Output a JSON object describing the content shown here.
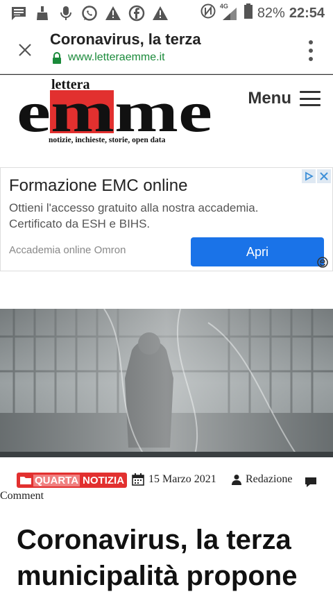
{
  "status_bar": {
    "battery": "82%",
    "time": "22:54",
    "network": "4G",
    "icons": [
      "message-icon",
      "broom-icon",
      "mic-icon",
      "whatsapp-icon",
      "warning-icon",
      "facebook-icon",
      "warning-icon",
      "nfc-icon",
      "signal-icon",
      "battery-icon"
    ]
  },
  "browser": {
    "title": "Coronavirus, la terza",
    "url": "www.letteraemme.it"
  },
  "site": {
    "logo_top": "lettera",
    "logo_word": "emme",
    "logo_tagline": "notizie, inchieste, storie, open data",
    "menu_label": "Menu"
  },
  "ad": {
    "title": "Formazione EMC online",
    "description": "Ottieni l'accesso gratuito alla nostra accademia. Certificato da ESH e BIHS.",
    "source": "Accademia online Omron",
    "button": "Apri",
    "accent": "#1a73e8"
  },
  "article": {
    "category_part1": "QUARTA",
    "category_part2": "NOTIZIA",
    "date": "15 Marzo 2021",
    "author": "Redazione",
    "comment_label": "Comment",
    "headline": "Coronavirus, la terza municipalità propone",
    "category_color": "#e2302f"
  }
}
